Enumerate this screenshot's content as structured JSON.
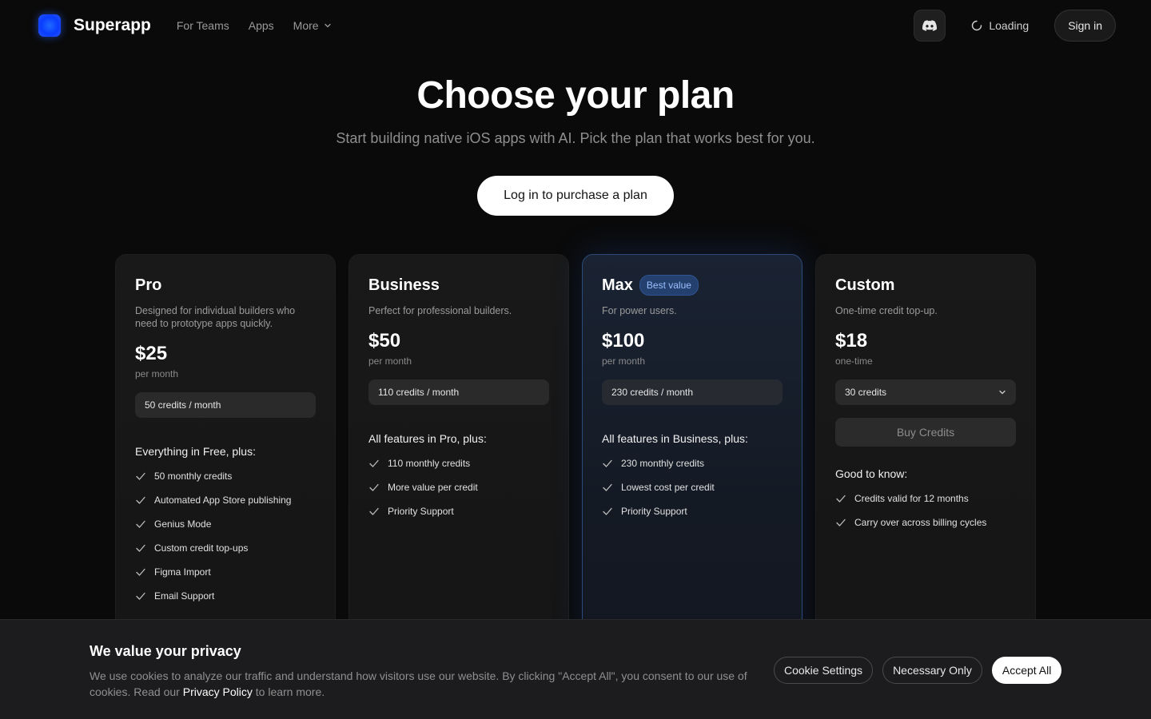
{
  "nav": {
    "brand": "Superapp",
    "links": [
      "For Teams",
      "Apps",
      "More"
    ],
    "loading_label": "Loading",
    "signin_label": "Sign in",
    "discord_icon": "discord-icon"
  },
  "hero": {
    "title": "Choose your plan",
    "subtitle": "Start building native iOS apps with AI. Pick the plan that works best for you.",
    "cta_label": "Log in to purchase a plan"
  },
  "plans": [
    {
      "name": "Pro",
      "description": "Designed for individual builders who need to prototype apps quickly.",
      "price": "$25",
      "period": "per month",
      "credits": "50 credits / month",
      "features_heading": "Everything in Free, plus:",
      "features": [
        "50 monthly credits",
        "Automated App Store publishing",
        "Genius Mode",
        "Custom credit top-ups",
        "Figma Import",
        "Email Support"
      ]
    },
    {
      "name": "Business",
      "description": "Perfect for professional builders.",
      "price": "$50",
      "period": "per month",
      "credits": "110 credits / month",
      "features_heading": "All features in Pro, plus:",
      "features": [
        "110 monthly credits",
        "More value per credit",
        "Priority Support"
      ]
    },
    {
      "name": "Max",
      "badge": "Best value",
      "description": "For power users.",
      "price": "$100",
      "period": "per month",
      "credits": "230 credits / month",
      "features_heading": "All features in Business, plus:",
      "features": [
        "230 monthly credits",
        "Lowest cost per credit",
        "Priority Support"
      ]
    },
    {
      "name": "Custom",
      "description": "One-time credit top-up.",
      "price": "$18",
      "period": "one-time",
      "credits": "30 credits",
      "buy_label": "Buy Credits",
      "features_heading": "Good to know:",
      "features": [
        "Credits valid for 12 months",
        "Carry over across billing cycles"
      ]
    }
  ],
  "cookie": {
    "title": "We value your privacy",
    "text_before": "We use cookies to analyze our traffic and understand how visitors use our website. By clicking \"Accept All\", you consent to our use of cookies. Read our ",
    "policy_link": "Privacy Policy",
    "text_after": " to learn more.",
    "settings_label": "Cookie Settings",
    "necessary_label": "Necessary Only",
    "accept_label": "Accept All"
  },
  "colors": {
    "background": "#0a0a0a",
    "accent_blue": "#1e6bff",
    "max_border": "#2c4a7a",
    "badge_bg": "#23406e"
  }
}
